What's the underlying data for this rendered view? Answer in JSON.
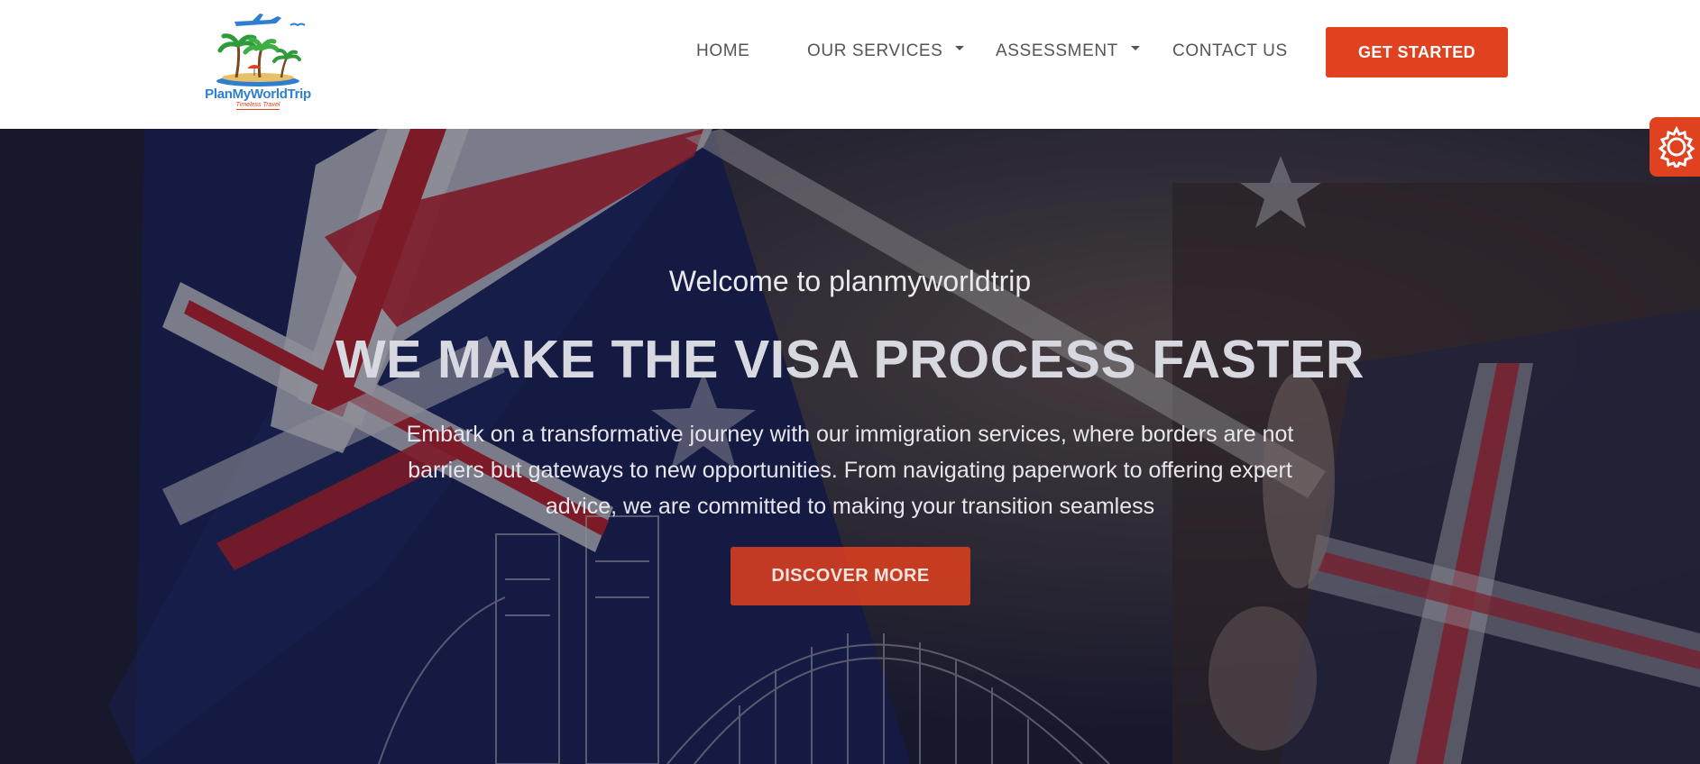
{
  "brand": {
    "name": "PlanMyWorldTrip",
    "tagline": "Timeless Travel"
  },
  "nav": {
    "home": "HOME",
    "services": "OUR SERVICES",
    "assessment": "ASSESSMENT",
    "contact": "CONTACT US",
    "cta": "GET STARTED"
  },
  "hero": {
    "welcome": "Welcome to planmyworldtrip",
    "headline": "WE MAKE THE VISA PROCESS FASTER",
    "description": "Embark on a transformative journey with our immigration services, where borders are not barriers but gateways to new opportunities. From navigating paperwork to offering expert advice, we are committed to making your transition seamless",
    "button": "DISCOVER MORE"
  },
  "icons": {
    "settings": "gear-icon",
    "dropdown": "chevron-down-icon",
    "logo": "island-plane-logo"
  },
  "colors": {
    "accent": "#e0411f",
    "brand_blue": "#2f7fd0",
    "nav_text": "#555555"
  }
}
